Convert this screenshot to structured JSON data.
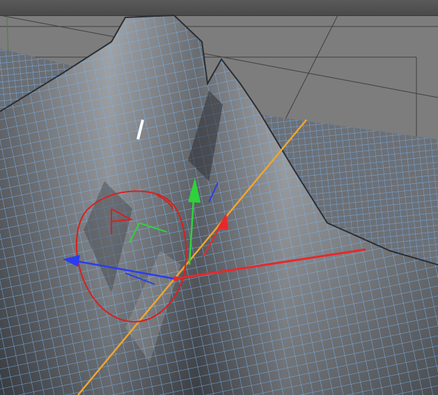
{
  "viewport": {
    "background": "#7d7d7d",
    "mesh_fill": "#5b5e63",
    "wire_color": "#79b3ee",
    "frame_color": "#2e2e2e"
  },
  "gizmo": {
    "axis_colors": {
      "x": "#e8282b",
      "y": "#2fd23a",
      "z": "#2a3cf0",
      "pivot_axis": "#f3a52a"
    },
    "rotate_ring_color": "#d7201f"
  }
}
